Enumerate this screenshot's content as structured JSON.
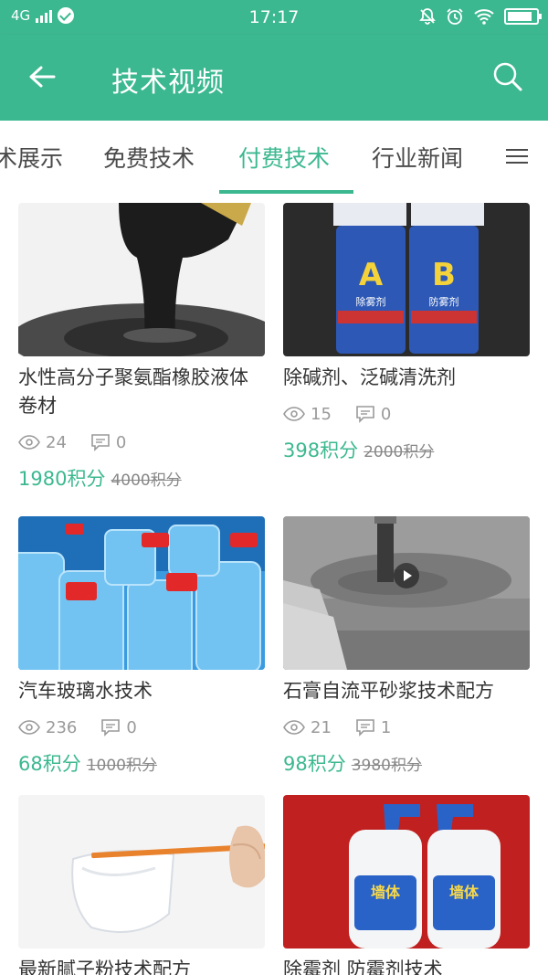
{
  "status_bar": {
    "network": "4G",
    "time": "17:17",
    "battery_level": 0.85
  },
  "header": {
    "back_icon": "arrow-left-icon",
    "title": "技术视频",
    "search_icon": "search-icon"
  },
  "tabs": [
    {
      "label": "术展示",
      "active": false
    },
    {
      "label": "免费技术",
      "active": false
    },
    {
      "label": "付费技术",
      "active": true
    },
    {
      "label": "行业新闻",
      "active": false
    }
  ],
  "menu_icon": "menu-icon",
  "cards": [
    {
      "title": "水性高分子聚氨酯橡胶液体卷材",
      "views": "24",
      "comments": "0",
      "price": "1980积分",
      "original_price": "4000积分"
    },
    {
      "title": "除碱剂、泛碱清洗剂",
      "views": "15",
      "comments": "0",
      "price": "398积分",
      "original_price": "2000积分",
      "product_labels": [
        "A",
        "B",
        "除雾剂",
        "防雾剂"
      ]
    },
    {
      "title": "汽车玻璃水技术",
      "views": "236",
      "comments": "0",
      "price": "68积分",
      "original_price": "1000积分"
    },
    {
      "title": "石膏自流平砂浆技术配方",
      "views": "21",
      "comments": "1",
      "price": "98积分",
      "original_price": "3980积分",
      "has_video": true
    },
    {
      "title": "最新腻子粉技术配方"
    },
    {
      "title": "除霉剂 防霉剂技术",
      "product_labels": [
        "墙体",
        "墙体"
      ]
    }
  ],
  "colors": {
    "accent": "#3cb890",
    "text": "#333333",
    "muted": "#9a9a9a"
  }
}
